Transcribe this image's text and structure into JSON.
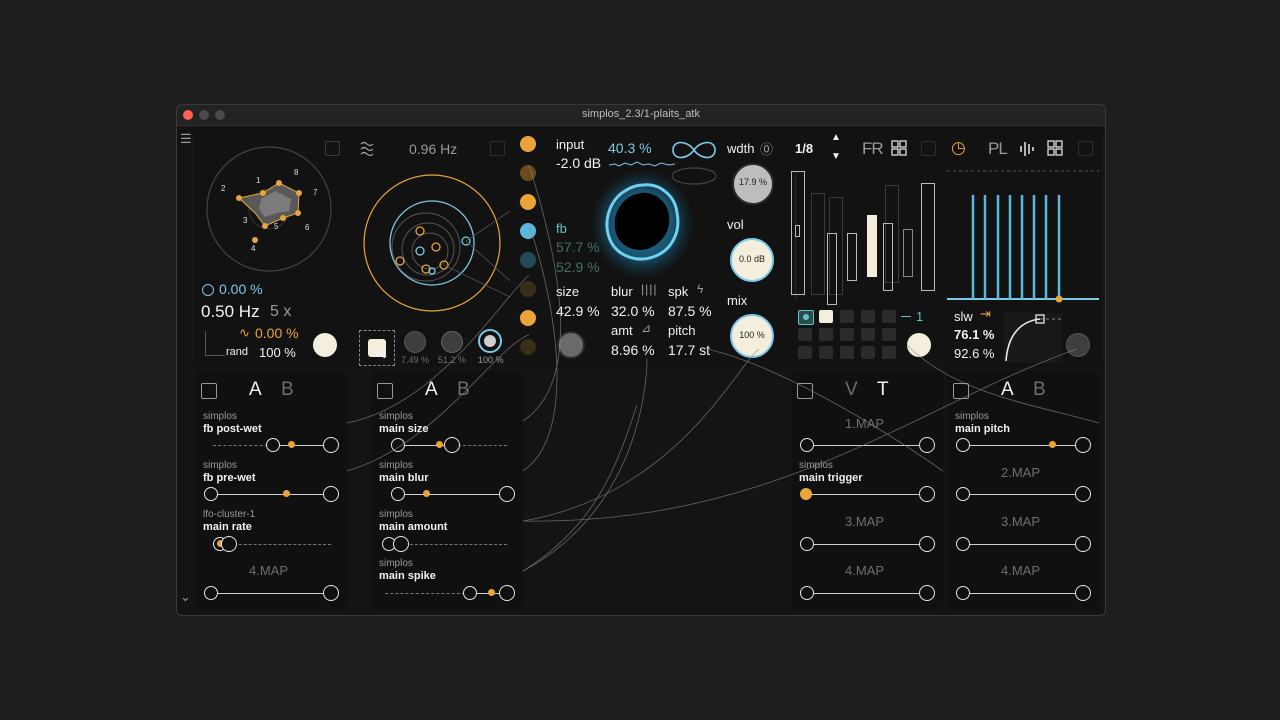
{
  "window": {
    "title": "simplos_2.3/1-plaits_atk"
  },
  "lfo": {
    "star_labels": [
      "1",
      "2",
      "3",
      "4",
      "5",
      "6",
      "7",
      "8"
    ],
    "depth": "0.00 %",
    "rate": "0.50 Hz",
    "mult": "5 x",
    "phase": "0.00 %",
    "rand_label": "rand",
    "rand_value": "100 %"
  },
  "orbit": {
    "freq": "0.96 Hz",
    "knob_values": [
      "7.49 %",
      "51.2 %",
      "100 %"
    ]
  },
  "fx": {
    "input_label": "input",
    "input_value": "-2.0 dB",
    "input_pct": "40.3 %",
    "fb_label": "fb",
    "fb_val1": "57.7 %",
    "fb_val2": "52.9 %",
    "size_label": "size",
    "size_value": "42.9 %",
    "blur_label": "blur",
    "blur_value": "32.0 %",
    "spk_label": "spk",
    "spk_value": "87.5 %",
    "amt_label": "amt",
    "amt_value": "8.96 %",
    "pitch_label": "pitch",
    "pitch_value": "17.7 st",
    "wdth_label": "wdth",
    "wdth_value": "17.9 %",
    "vol_label": "vol",
    "vol_value": "0.0 dB",
    "mix_label": "mix",
    "mix_value": "100 %"
  },
  "seq": {
    "division": "1/8",
    "fr_label": "FR",
    "step_count": "1"
  },
  "env": {
    "pl_label": "PL",
    "slw_label": "slw",
    "slw_value": "76.1 %",
    "curve_value": "92.6 %"
  },
  "map_panels": [
    {
      "tabs": [
        "A",
        "B"
      ],
      "slots": [
        {
          "device": "simplos",
          "param": "fb post-wet"
        },
        {
          "device": "simplos",
          "param": "fb pre-wet"
        },
        {
          "device": "lfo-cluster-1",
          "param": "main rate"
        },
        {
          "device": "",
          "param": "4.MAP"
        }
      ]
    },
    {
      "tabs": [
        "A",
        "B"
      ],
      "slots": [
        {
          "device": "simplos",
          "param": "main size"
        },
        {
          "device": "simplos",
          "param": "main blur"
        },
        {
          "device": "simplos",
          "param": "main amount"
        },
        {
          "device": "simplos",
          "param": "main spike"
        }
      ]
    },
    {
      "tabs": [
        "V",
        "T"
      ],
      "slots": [
        {
          "device": "",
          "param": "1.MAP"
        },
        {
          "device": "simplos",
          "param": "main trigger"
        },
        {
          "device": "",
          "param": "3.MAP"
        },
        {
          "device": "",
          "param": "4.MAP"
        }
      ]
    },
    {
      "tabs": [
        "A",
        "B"
      ],
      "slots": [
        {
          "device": "simplos",
          "param": "main pitch"
        },
        {
          "device": "",
          "param": "2.MAP"
        },
        {
          "device": "",
          "param": "3.MAP"
        },
        {
          "device": "",
          "param": "4.MAP"
        }
      ]
    }
  ],
  "colors": {
    "accent_orange": "#e9a53a",
    "accent_blue": "#7cc9e8",
    "teal": "#62c4c2"
  },
  "icons": [
    "menu-icon",
    "wave-icon",
    "infinity-icon",
    "grid-icon",
    "clock-icon",
    "bars-icon",
    "list-icon",
    "chevron-down-icon"
  ]
}
